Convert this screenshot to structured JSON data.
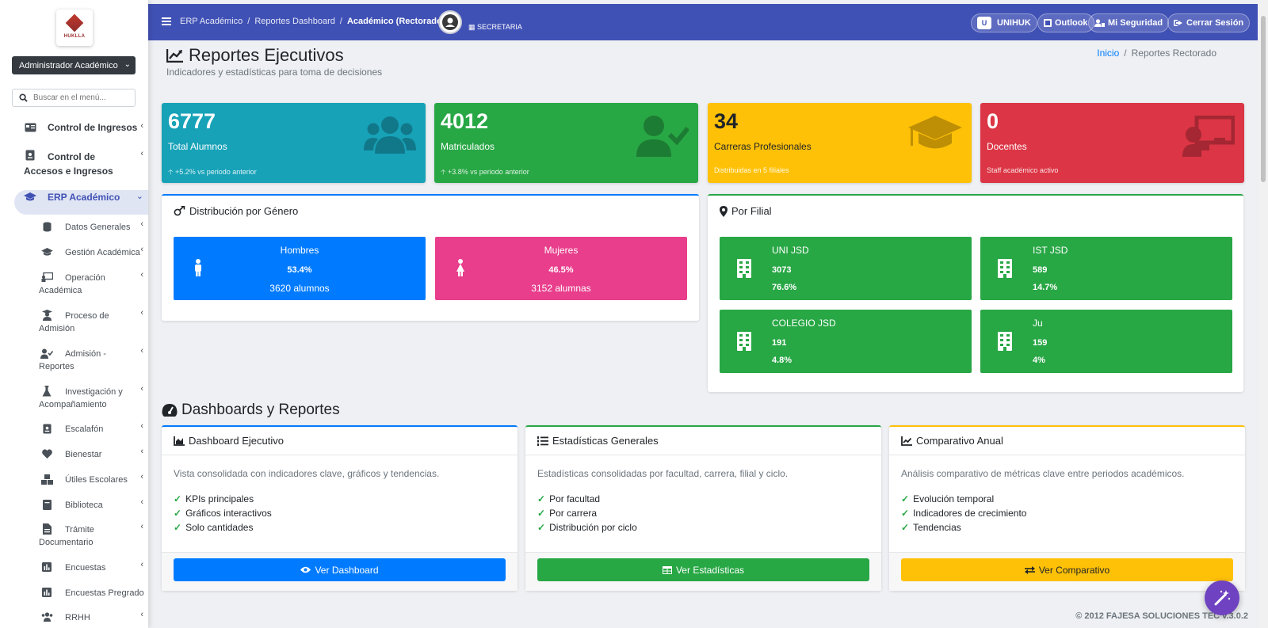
{
  "colors": {
    "primary": "#4051b5",
    "teal": "#17a2b8",
    "green": "#28a745",
    "yellow": "#ffc107",
    "red": "#dc3545",
    "blue": "#007bff",
    "pink": "#e83e8c"
  },
  "sidebar": {
    "logo_text": "HUKLLA",
    "role": "Administrador Académico",
    "search_placeholder": "Buscar en el menú...",
    "top_items": [
      {
        "label": "Control de Ingresos",
        "icon": "id-card-icon"
      },
      {
        "label": "Control de Accesos e Ingresos",
        "icon": "id-badge-icon"
      },
      {
        "label": "ERP Académico",
        "icon": "graduation-cap-icon",
        "active": true
      }
    ],
    "sub_items": [
      {
        "label": "Datos Generales",
        "icon": "database-icon"
      },
      {
        "label": "Gestión Académica",
        "icon": "graduation-cap-icon"
      },
      {
        "label": "Operación Académica",
        "icon": "chalkboard-icon"
      },
      {
        "label": "Proceso de Admisión",
        "icon": "user-graduate-icon"
      },
      {
        "label": "Admisión - Reportes",
        "icon": "user-check-icon"
      },
      {
        "label": "Investigación y Acompañamiento",
        "icon": "flask-icon"
      },
      {
        "label": "Escalafón",
        "icon": "id-badge-icon"
      },
      {
        "label": "Bienestar",
        "icon": "heart-icon"
      },
      {
        "label": "Útiles Escolares",
        "icon": "boxes-icon"
      },
      {
        "label": "Biblioteca",
        "icon": "book-icon"
      },
      {
        "label": "Trámite Documentario",
        "icon": "file-icon"
      },
      {
        "label": "Encuestas",
        "icon": "poll-icon"
      },
      {
        "label": "Encuestas Pregrado",
        "icon": "poll-icon"
      },
      {
        "label": "RRHH",
        "icon": "users-icon"
      }
    ]
  },
  "topbar": {
    "breadcrumbs": [
      "ERP Académico",
      "Reportes Dashboard",
      "Académico (Rectorado)"
    ],
    "secretaria": "SECRETARIA",
    "u_badge": "U",
    "org": "UNIHUK",
    "outlook": "Outlook",
    "security": "Mi Seguridad",
    "logout": "Cerrar Sesión"
  },
  "header": {
    "title": "Reportes Ejecutivos",
    "subtitle": "Indicadores y estadísticas para toma de decisiones",
    "crumb_home": "Inicio",
    "crumb_current": "Reportes Rectorado"
  },
  "stats": [
    {
      "value": "6777",
      "label": "Total Alumnos",
      "foot": "+5.2% vs periodo anterior",
      "icon": "users-icon"
    },
    {
      "value": "4012",
      "label": "Matriculados",
      "foot": "+3.8% vs periodo anterior",
      "icon": "user-check-icon"
    },
    {
      "value": "34",
      "label": "Carreras Profesionales",
      "foot": "Distribuidas en 5 filiales",
      "icon": "graduation-cap-icon"
    },
    {
      "value": "0",
      "label": "Docentes",
      "foot": "Staff académico activo",
      "icon": "chalkboard-teacher-icon"
    }
  ],
  "gender": {
    "title": "Distribución por Género",
    "men": {
      "label": "Hombres",
      "pct": "53.4%",
      "count": "3620 alumnos"
    },
    "women": {
      "label": "Mujeres",
      "pct": "46.5%",
      "count": "3152 alumnas"
    }
  },
  "filial": {
    "title": "Por Filial",
    "items": [
      {
        "name": "UNI JSD",
        "value": "3073",
        "pct": "76.6%"
      },
      {
        "name": "IST JSD",
        "value": "589",
        "pct": "14.7%"
      },
      {
        "name": "COLEGIO JSD",
        "value": "191",
        "pct": "4.8%"
      },
      {
        "name": "Ju",
        "value": "159",
        "pct": "4%"
      }
    ]
  },
  "dashboards": {
    "title": "Dashboards y Reportes",
    "cards": [
      {
        "title": "Dashboard Ejecutivo",
        "desc": "Vista consolidada con indicadores clave, gráficos y tendencias.",
        "items": [
          "KPIs principales",
          "Gráficos interactivos",
          "Solo cantidades"
        ],
        "button": "Ver Dashboard"
      },
      {
        "title": "Estadísticas Generales",
        "desc": "Estadísticas consolidadas por facultad, carrera, filial y ciclo.",
        "items": [
          "Por facultad",
          "Por carrera",
          "Distribución por ciclo"
        ],
        "button": "Ver Estadísticas"
      },
      {
        "title": "Comparativo Anual",
        "desc": "Análisis comparativo de métricas clave entre periodos académicos.",
        "items": [
          "Evolución temporal",
          "Indicadores de crecimiento",
          "Tendencias"
        ],
        "button": "Ver Comparativo"
      }
    ]
  },
  "footer": "© 2012 FAJESA SOLUCIONES TEC v.3.0.2"
}
